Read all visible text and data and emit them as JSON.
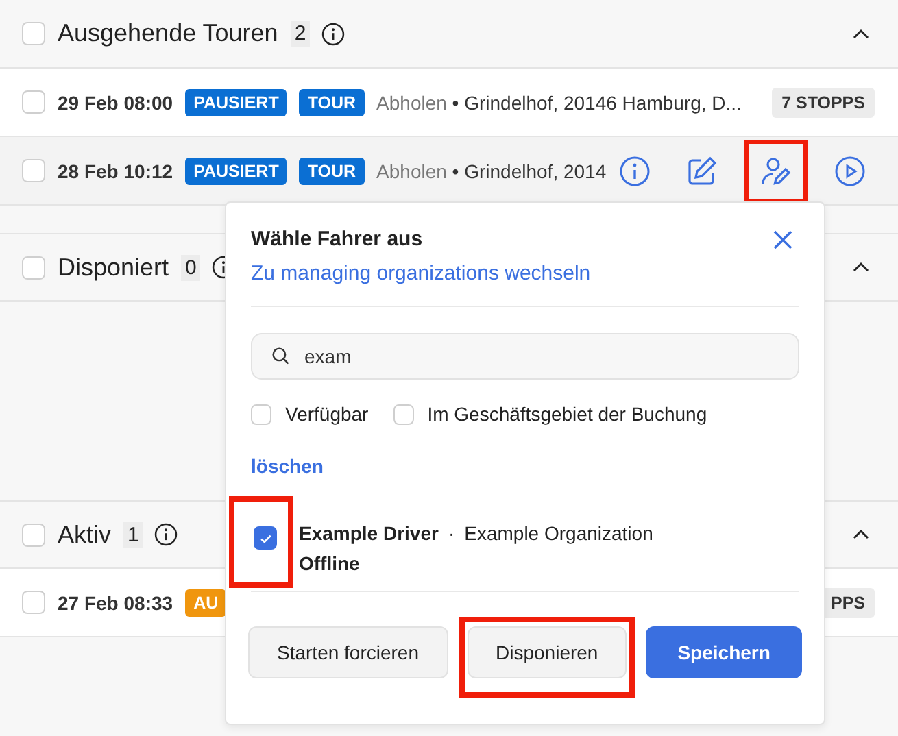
{
  "sections": [
    {
      "title": "Ausgehende Touren",
      "count": "2",
      "checked": false,
      "expanded": true,
      "rows": [
        {
          "checked": false,
          "hovered": false,
          "date": "29 Feb 08:00",
          "badges": [
            {
              "text": "PAUSIERT",
              "color": "#0b6fd3"
            },
            {
              "text": "TOUR",
              "color": "#0b6fd3"
            }
          ],
          "action": "Abholen",
          "address": "• Grindelhof, 20146 Hamburg, D...",
          "stops": "7 STOPPS"
        },
        {
          "checked": false,
          "hovered": true,
          "date": "28 Feb 10:12",
          "badges": [
            {
              "text": "PAUSIERT",
              "color": "#0b6fd3"
            },
            {
              "text": "TOUR",
              "color": "#0b6fd3"
            }
          ],
          "action": "Abholen",
          "address": "• Grindelhof, 2014",
          "row_actions": [
            {
              "kind": "info",
              "highlighted": false
            },
            {
              "kind": "edit",
              "highlighted": false
            },
            {
              "kind": "assign",
              "highlighted": true
            },
            {
              "kind": "start",
              "highlighted": false
            }
          ]
        }
      ]
    },
    {
      "title": "Disponiert",
      "count": "0",
      "checked": false,
      "expanded": true
    },
    {
      "title": "Aktiv",
      "count": "1",
      "checked": false,
      "expanded": true,
      "rows": [
        {
          "checked": false,
          "hovered": false,
          "date": "27 Feb 08:33",
          "badges": [
            {
              "text": "AU",
              "color": "#f0960e"
            }
          ],
          "stops": "PPS"
        }
      ]
    }
  ],
  "popup": {
    "title": "Wähle Fahrer aus",
    "link": "Zu managing organizations wechseln",
    "search": {
      "value": "exam"
    },
    "filters": [
      {
        "label": "Verfügbar",
        "checked": false
      },
      {
        "label": "Im Geschäftsgebiet der Buchung",
        "checked": false
      }
    ],
    "clear": "löschen",
    "drivers": [
      {
        "name": "Example Driver",
        "separator": "·",
        "organization": "Example Organization",
        "status": "Offline",
        "checked": true,
        "highlighted": true
      }
    ],
    "buttons": [
      {
        "label": "Starten forcieren",
        "kind": "secondary",
        "highlighted": false
      },
      {
        "label": "Disponieren",
        "kind": "secondary",
        "highlighted": true
      },
      {
        "label": "Speichern",
        "kind": "primary",
        "highlighted": false
      }
    ]
  }
}
